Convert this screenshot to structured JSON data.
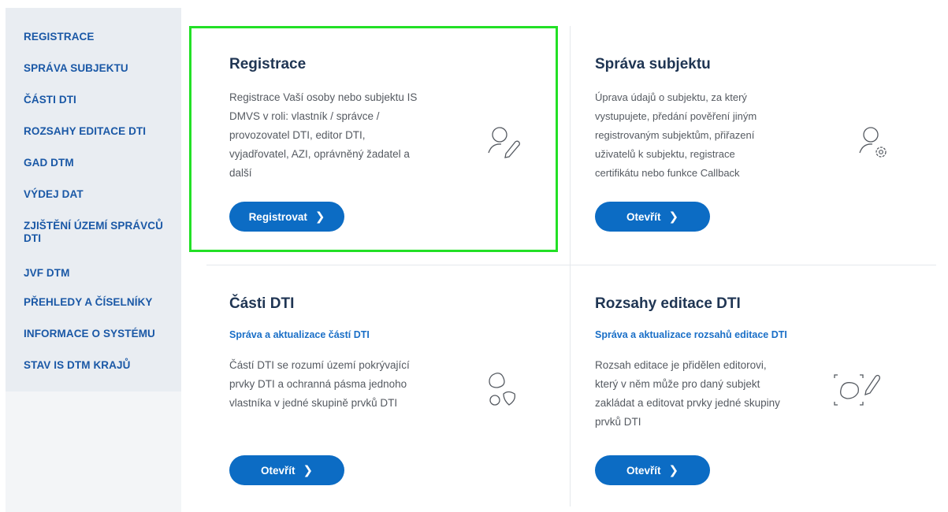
{
  "sidebar": {
    "items": [
      {
        "label": "REGISTRACE"
      },
      {
        "label": "SPRÁVA SUBJEKTU"
      },
      {
        "label": "ČÁSTI DTI"
      },
      {
        "label": "ROZSAHY EDITACE DTI"
      },
      {
        "label": "GAD DTM"
      },
      {
        "label": "VÝDEJ DAT"
      },
      {
        "label": "ZJIŠTĚNÍ ÚZEMÍ SPRÁVCŮ"
      },
      {
        "label": "DTI"
      },
      {
        "label": "JVF DTM"
      },
      {
        "label": "PŘEHLEDY A ČÍSELNÍKY"
      },
      {
        "label": "INFORMACE O SYSTÉMU"
      },
      {
        "label": "STAV IS DTM KRAJŮ"
      }
    ]
  },
  "cards": {
    "registrace": {
      "title": "Registrace",
      "desc": [
        "Registrace Vaší osoby nebo subjektu IS",
        "DMVS v roli: vlastník / správce /",
        "provozovatel DTI, editor DTI,",
        "vyjadřovatel, AZI, oprávněný žadatel a",
        "další"
      ],
      "button": "Registrovat",
      "icon": "user-edit-icon"
    },
    "sprava": {
      "title": "Správa subjektu",
      "desc": [
        "Úprava údajů o subjektu, za který",
        "vystupujete, předání pověření jiným",
        "registrovaným subjektům, přiřazení",
        "uživatelů k subjektu, registrace",
        "certifikátu nebo funkce Callback"
      ],
      "button": "Otevřít",
      "icon": "user-settings-icon"
    },
    "casti": {
      "title": "Části DTI",
      "subtitle": "Správa a aktualizace částí DTI",
      "desc": [
        "Částí DTI se rozumí území pokrývající",
        "prvky DTI a ochranná pásma jednoho",
        "vlastníka v jedné skupině prvků DTI"
      ],
      "button": "Otevřít",
      "icon": "shapes-icon"
    },
    "rozsahy": {
      "title": "Rozsahy editace DTI",
      "subtitle": "Správa a aktualizace rozsahů editace DTI",
      "desc": [
        "Rozsah editace je přidělen editorovi,",
        "který v něm může pro daný subjekt",
        "zakládat a editovat prvky jedné skupiny",
        "prvků DTI"
      ],
      "button": "Otevřít",
      "icon": "area-edit-icon"
    }
  },
  "colors": {
    "accent": "#0c6cc4",
    "sidebar_bg": "#e9edf2",
    "highlight": "#22e026",
    "title": "#1f3553"
  }
}
